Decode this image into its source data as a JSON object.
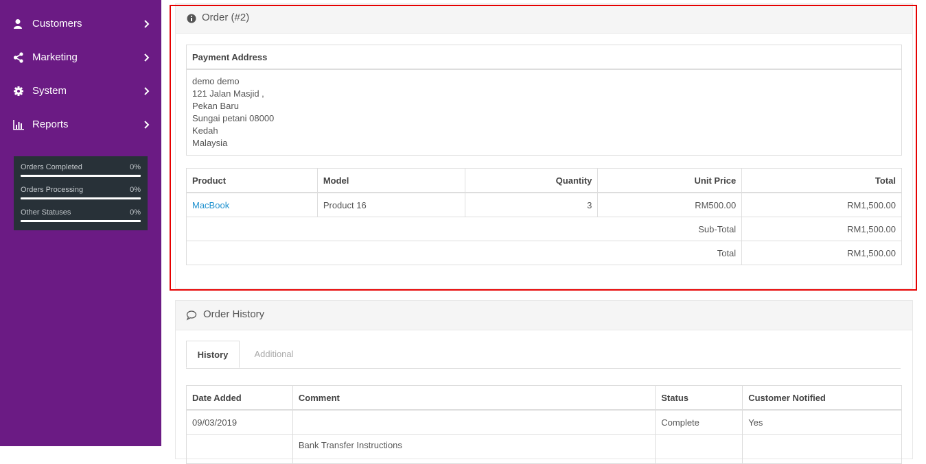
{
  "sidebar": {
    "items": [
      {
        "label": "Customers",
        "icon": "user-icon"
      },
      {
        "label": "Marketing",
        "icon": "share-icon"
      },
      {
        "label": "System",
        "icon": "gear-icon"
      },
      {
        "label": "Reports",
        "icon": "bar-chart-icon"
      }
    ],
    "stats": [
      {
        "label": "Orders Completed",
        "value": "0%",
        "progress": 0
      },
      {
        "label": "Orders Processing",
        "value": "0%",
        "progress": 0
      },
      {
        "label": "Other Statuses",
        "value": "0%",
        "progress": 0
      }
    ]
  },
  "order": {
    "title": "Order (#2)",
    "payment_address_heading": "Payment Address",
    "address_lines": [
      "demo demo",
      "121 Jalan Masjid ,",
      "Pekan Baru",
      "Sungai petani 08000",
      "Kedah",
      "Malaysia"
    ],
    "columns": [
      "Product",
      "Model",
      "Quantity",
      "Unit Price",
      "Total"
    ],
    "products": [
      {
        "product": "MacBook",
        "model": "Product 16",
        "quantity": "3",
        "unit_price": "RM500.00",
        "total": "RM1,500.00"
      }
    ],
    "totals": [
      {
        "label": "Sub-Total",
        "value": "RM1,500.00"
      },
      {
        "label": "Total",
        "value": "RM1,500.00"
      }
    ]
  },
  "history": {
    "title": "Order History",
    "tabs": [
      "History",
      "Additional"
    ],
    "columns": [
      "Date Added",
      "Comment",
      "Status",
      "Customer Notified"
    ],
    "rows": [
      {
        "date": "09/03/2019",
        "comment": "",
        "status": "Complete",
        "notified": "Yes"
      },
      {
        "date": "",
        "comment": "Bank Transfer Instructions",
        "status": "",
        "notified": ""
      }
    ]
  },
  "colors": {
    "sidebar": "#6b1b84",
    "link": "#1e91cf",
    "highlight": "#e60000"
  }
}
